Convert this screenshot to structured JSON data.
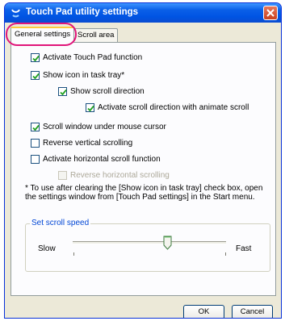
{
  "window": {
    "title": "Touch Pad utility settings"
  },
  "tabs": [
    {
      "label": "General settings",
      "active": true
    },
    {
      "label": "Scroll area",
      "active": false
    }
  ],
  "options": [
    {
      "label": "Activate Touch Pad function",
      "checked": true,
      "enabled": true
    },
    {
      "label": "Show icon in task tray*",
      "checked": true,
      "enabled": true
    },
    {
      "label": "Show scroll direction",
      "checked": true,
      "enabled": true
    },
    {
      "label": "Activate scroll direction with animate scroll",
      "checked": true,
      "enabled": true
    },
    {
      "label": "Scroll window under mouse cursor",
      "checked": true,
      "enabled": true
    },
    {
      "label": "Reverse vertical scrolling",
      "checked": false,
      "enabled": true
    },
    {
      "label": "Activate horizontal scroll function",
      "checked": false,
      "enabled": true
    },
    {
      "label": "Reverse horizontal scrolling",
      "checked": false,
      "enabled": false
    }
  ],
  "note": "* To use after clearing the [Show icon in task tray] check box, open the settings window from [Touch Pad settings] in the Start menu.",
  "scroll_speed": {
    "title": "Set scroll speed",
    "min_label": "Slow",
    "max_label": "Fast",
    "level": 0.62
  },
  "buttons": {
    "ok": "OK",
    "cancel": "Cancel"
  },
  "colors": {
    "titlebar": "#0054e3",
    "tab_highlight": "#e0157a",
    "group_title": "#0046d5"
  }
}
